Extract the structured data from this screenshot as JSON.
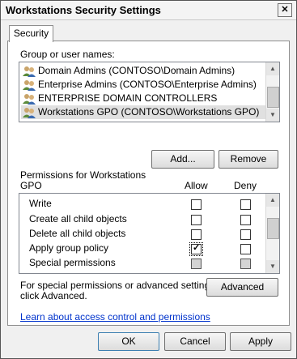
{
  "window": {
    "title": "Workstations Security Settings",
    "close_label": "✕"
  },
  "tab": {
    "label": "Security"
  },
  "groups": {
    "label": "Group or user names:",
    "items": [
      {
        "label": "Domain Admins (CONTOSO\\Domain Admins)",
        "icon": "group-icon"
      },
      {
        "label": "Enterprise Admins (CONTOSO\\Enterprise Admins)",
        "icon": "group-icon"
      },
      {
        "label": "ENTERPRISE DOMAIN CONTROLLERS",
        "icon": "group-icon"
      },
      {
        "label": "Workstations GPO (CONTOSO\\Workstations GPO)",
        "icon": "group-icon",
        "selected": true
      }
    ]
  },
  "buttons": {
    "add": "Add...",
    "remove": "Remove",
    "advanced": "Advanced",
    "ok": "OK",
    "cancel": "Cancel",
    "apply": "Apply"
  },
  "permissions": {
    "label_line1": "Permissions for Workstations",
    "label_line2": "GPO",
    "allow_header": "Allow",
    "deny_header": "Deny",
    "rows": [
      {
        "label": "Write",
        "allow": false,
        "deny": false,
        "disabled": false
      },
      {
        "label": "Create all child objects",
        "allow": false,
        "deny": false,
        "disabled": false
      },
      {
        "label": "Delete all child objects",
        "allow": false,
        "deny": false,
        "disabled": false
      },
      {
        "label": "Apply group policy",
        "allow": true,
        "deny": false,
        "disabled": false
      },
      {
        "label": "Special permissions",
        "allow": false,
        "deny": false,
        "disabled": true
      }
    ]
  },
  "advanced_note": {
    "line1": "For special permissions or advanced settings,",
    "line2": "click Advanced."
  },
  "help_link": "Learn about access control and permissions"
}
